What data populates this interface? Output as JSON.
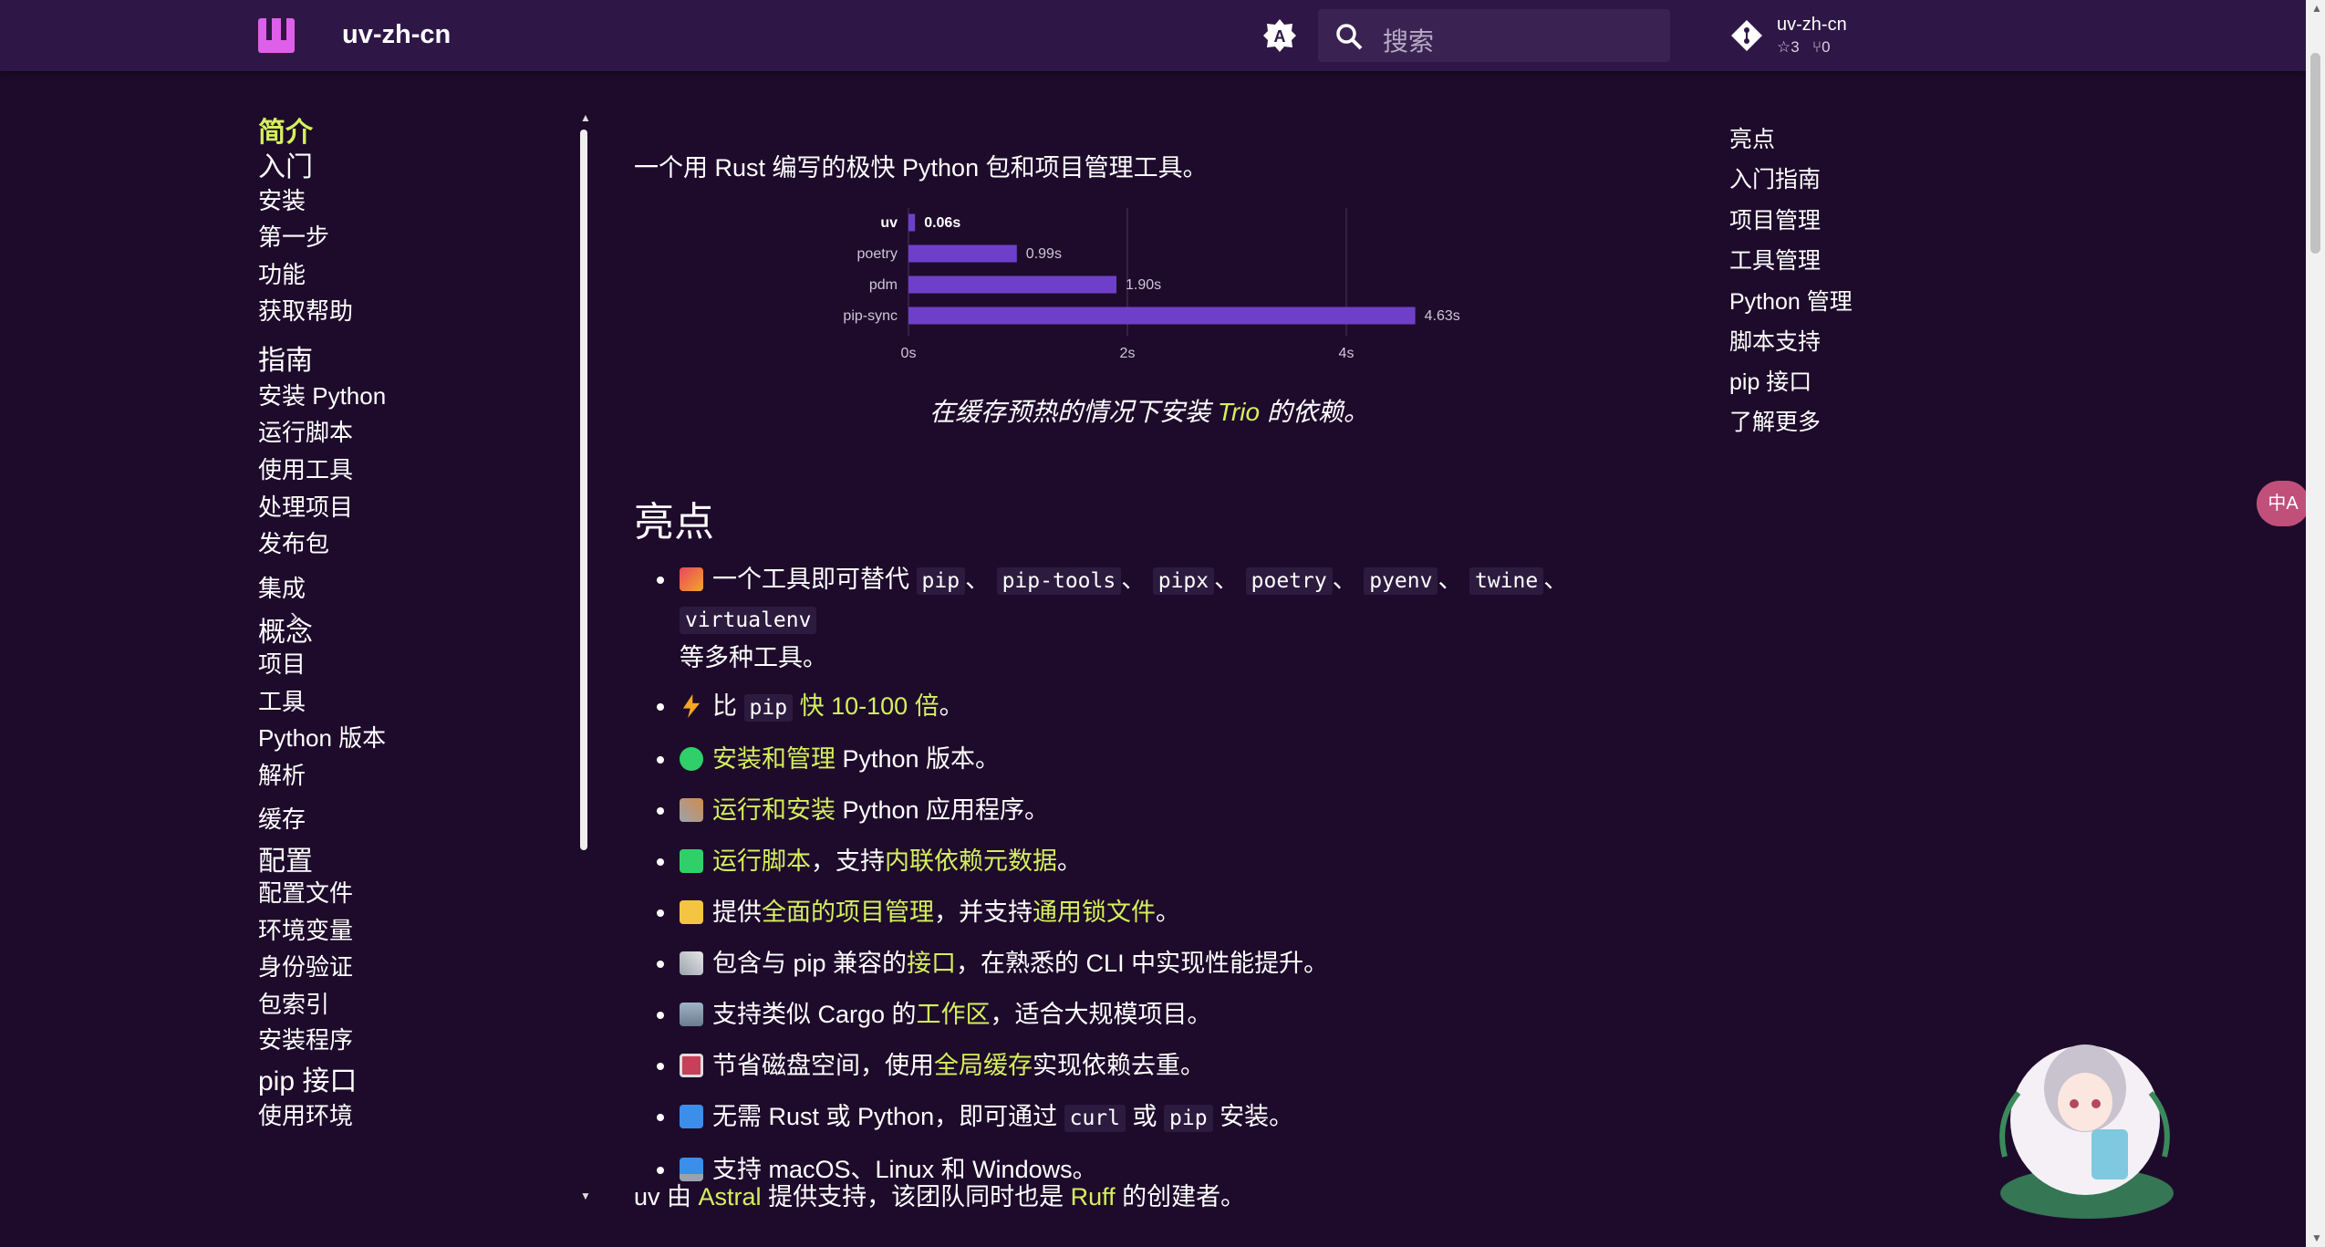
{
  "header": {
    "site_title": "uv-zh-cn",
    "search_placeholder": "搜索",
    "repo": {
      "name": "uv-zh-cn",
      "stars": "3",
      "forks": "0"
    }
  },
  "nav": {
    "items": [
      {
        "label": "简介",
        "type": "active"
      },
      {
        "label": "入门",
        "type": "section"
      },
      {
        "label": "安装",
        "type": "item"
      },
      {
        "label": "第一步",
        "type": "item"
      },
      {
        "label": "功能",
        "type": "item"
      },
      {
        "label": "获取帮助",
        "type": "item"
      },
      {
        "label": "指南",
        "type": "section"
      },
      {
        "label": "安装 Python",
        "type": "item"
      },
      {
        "label": "运行脚本",
        "type": "item"
      },
      {
        "label": "使用工具",
        "type": "item"
      },
      {
        "label": "处理项目",
        "type": "item"
      },
      {
        "label": "发布包",
        "type": "item"
      },
      {
        "label": "集成",
        "type": "item"
      },
      {
        "label": "概念",
        "type": "section"
      },
      {
        "label": "项目",
        "type": "item"
      },
      {
        "label": "工具",
        "type": "item"
      },
      {
        "label": "Python 版本",
        "type": "item"
      },
      {
        "label": "解析",
        "type": "item"
      },
      {
        "label": "缓存",
        "type": "item"
      },
      {
        "label": "配置",
        "type": "section"
      },
      {
        "label": "配置文件",
        "type": "item"
      },
      {
        "label": "环境变量",
        "type": "item"
      },
      {
        "label": "身份验证",
        "type": "item"
      },
      {
        "label": "包索引",
        "type": "item"
      },
      {
        "label": "安装程序",
        "type": "item"
      },
      {
        "label": "pip 接口",
        "type": "section"
      },
      {
        "label": "使用环境",
        "type": "item"
      }
    ]
  },
  "main": {
    "intro": "一个用 Rust 编写的极快 Python 包和项目管理工具。",
    "caption_pre": "在缓存预热的情况下安装 ",
    "caption_link": "Trio",
    "caption_post": " 的依赖。",
    "heading": "亮点",
    "outro_1": "uv 由 ",
    "outro_link1": "Astral",
    "outro_2": " 提供支持，该团队同时也是 ",
    "outro_link2": "Ruff",
    "outro_3": " 的创建者。"
  },
  "features": {
    "f1_text": "一个工具即可替代",
    "f1_codes": [
      "pip",
      "pip-tools",
      "pipx",
      "poetry",
      "pyenv",
      "twine",
      "virtualenv"
    ],
    "f1_sep": "、",
    "f1_tail": "等多种工具。",
    "f2_a": "比",
    "f2_code": "pip",
    "f2_link": "快 10-100 倍",
    "f2_end": "。",
    "f3_link": "安装和管理",
    "f3_text": " Python 版本。",
    "f4_link": "运行和安装",
    "f4_text": " Python 应用程序。",
    "f5_link": "运行脚本",
    "f5_mid": "，支持",
    "f5_link2": "内联依赖元数据",
    "f5_end": "。",
    "f6_a": "提供",
    "f6_link": "全面的项目管理",
    "f6_mid": "，并支持",
    "f6_link2": "通用锁文件",
    "f6_end": "。",
    "f7_a": "包含与 pip 兼容的",
    "f7_link": "接口",
    "f7_end": "，在熟悉的 CLI 中实现性能提升。",
    "f8_a": "支持类似 Cargo 的",
    "f8_link": "工作区",
    "f8_end": "，适合大规模项目。",
    "f9_a": "节省磁盘空间，使用",
    "f9_link": "全局缓存",
    "f9_end": "实现依赖去重。",
    "f10_a": "无需 Rust 或 Python，即可通过",
    "f10_code1": "curl",
    "f10_mid": "或",
    "f10_code2": "pip",
    "f10_end": "安装。",
    "f11": "支持 macOS、Linux 和 Windows。"
  },
  "toc": [
    "亮点",
    "入门指南",
    "项目管理",
    "工具管理",
    "Python 管理",
    "脚本支持",
    "pip 接口",
    "了解更多"
  ],
  "translate_label": "中A",
  "chart_data": {
    "type": "bar",
    "orientation": "horizontal",
    "categories": [
      "uv",
      "poetry",
      "pdm",
      "pip-sync"
    ],
    "values": [
      0.06,
      0.99,
      1.9,
      4.63
    ],
    "value_labels": [
      "0.06s",
      "0.99s",
      "1.90s",
      "4.63s"
    ],
    "xticks": [
      "0s",
      "2s",
      "4s"
    ],
    "xlim": [
      0,
      4.63
    ],
    "bar_color": "#6e40c9",
    "grid": true
  },
  "colors": {
    "accent": "#d4f05c",
    "background": "#1e0b2b",
    "header": "#2e1746"
  }
}
